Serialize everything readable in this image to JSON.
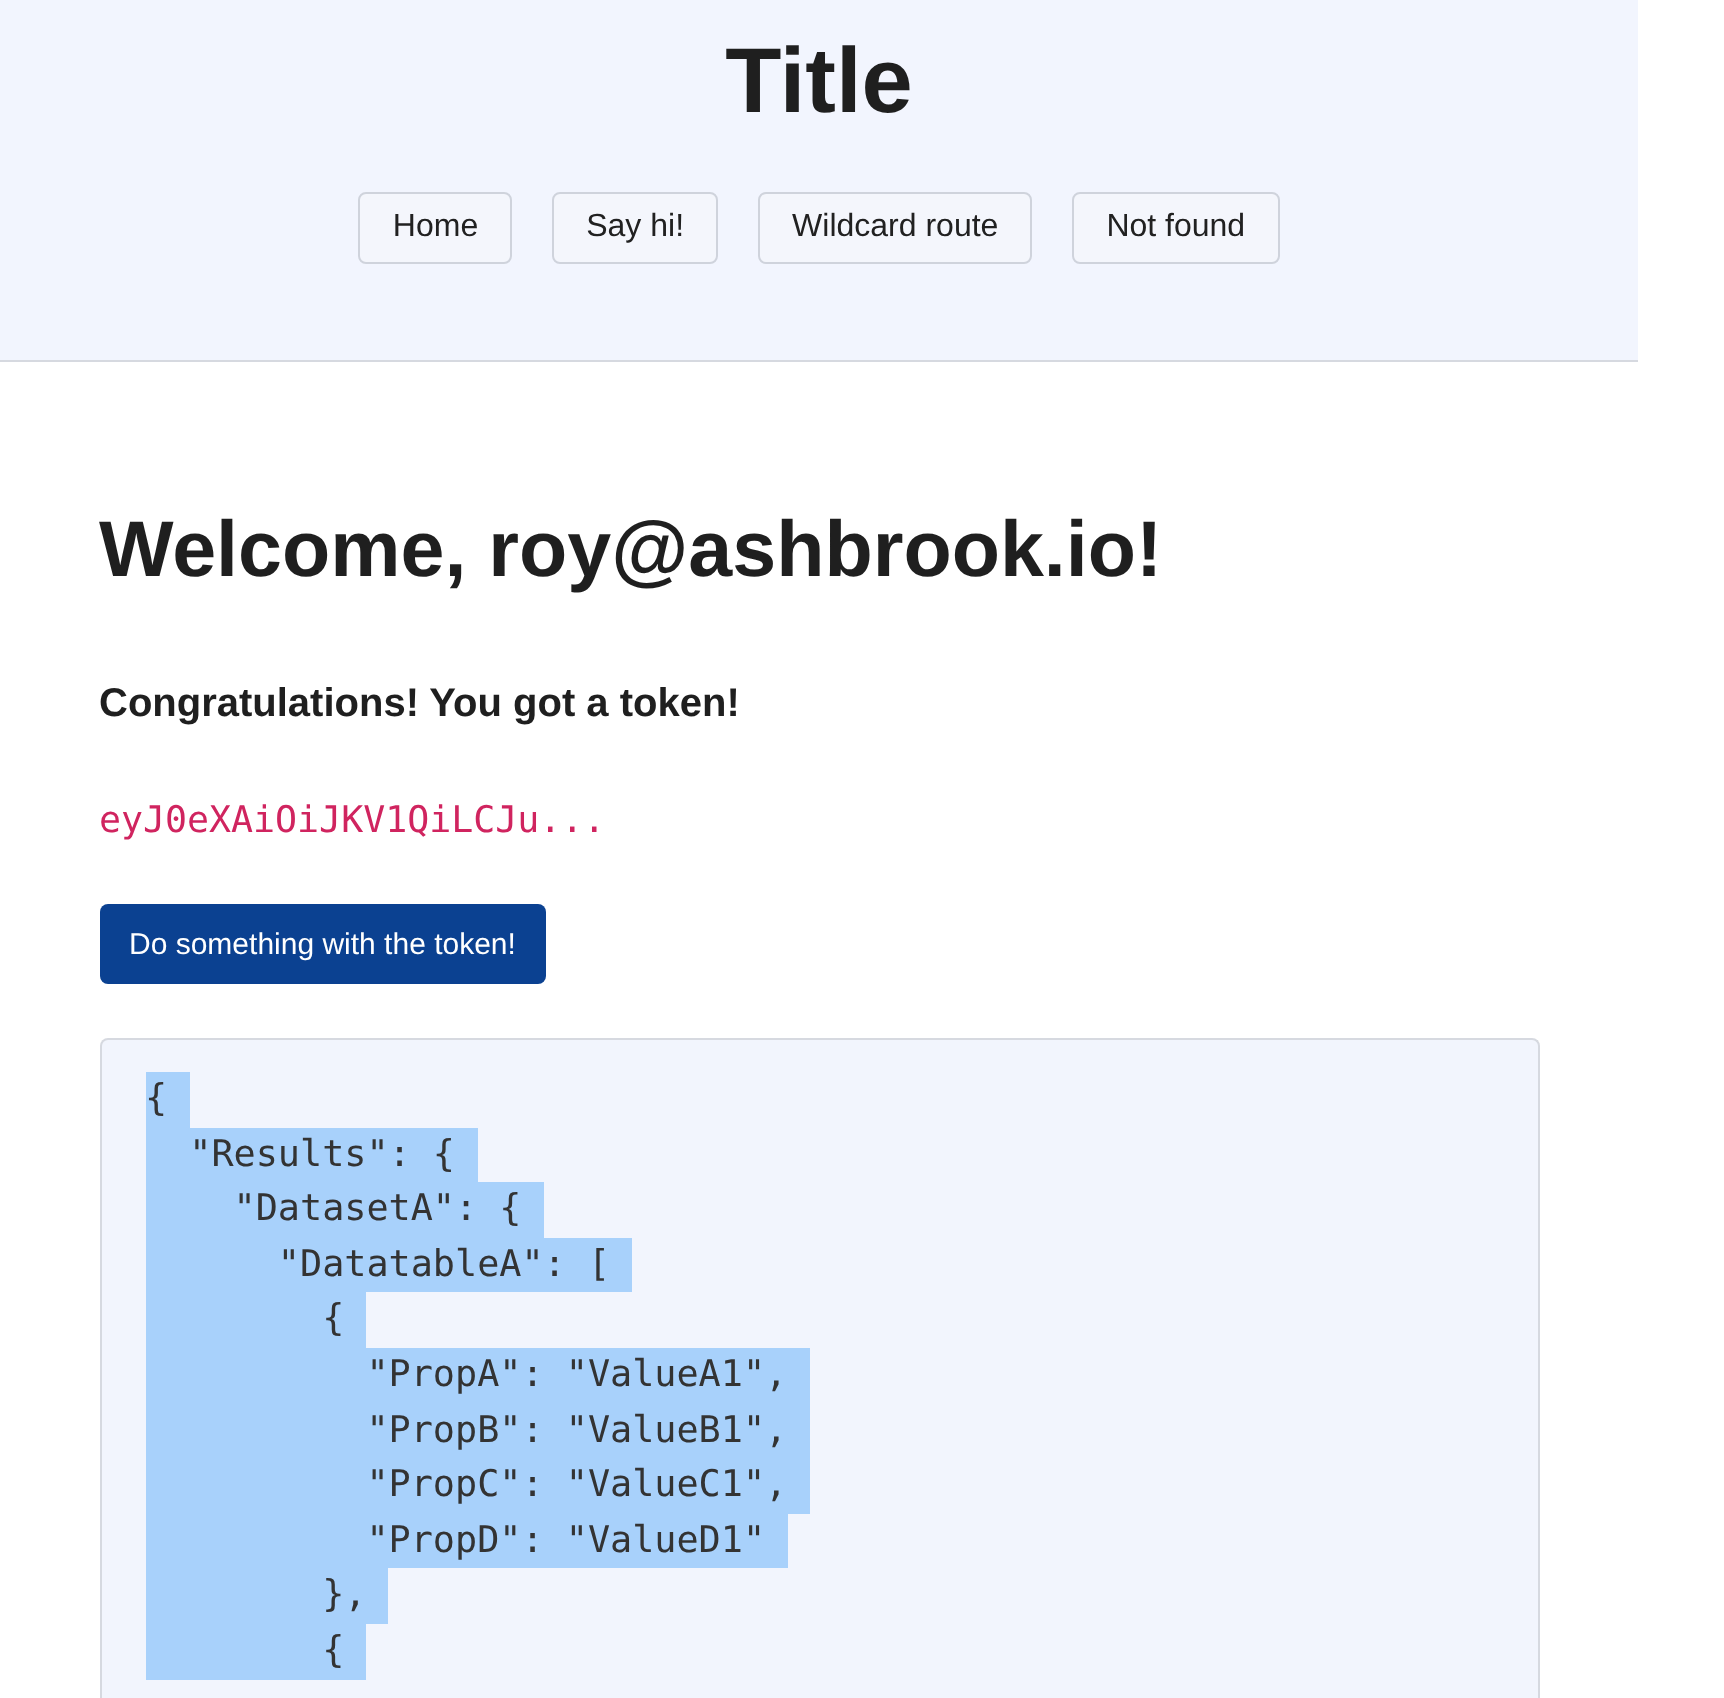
{
  "header": {
    "title": "Title",
    "nav": [
      {
        "label": "Home"
      },
      {
        "label": "Say hi!"
      },
      {
        "label": "Wildcard route"
      },
      {
        "label": "Not found"
      }
    ]
  },
  "main": {
    "heading": "Welcome, roy@ashbrook.io!",
    "subheading": "Congratulations! You got a token!",
    "token": "eyJ0eXAiOiJKV1QiLCJu...",
    "action_button": "Do something with the token!",
    "code_block": {
      "highlighted": true,
      "lines": [
        "{",
        "  \"Results\": {",
        "    \"DatasetA\": {",
        "      \"DatatableA\": [",
        "        {",
        "          \"PropA\": \"ValueA1\",",
        "          \"PropB\": \"ValueB1\",",
        "          \"PropC\": \"ValueC1\",",
        "          \"PropD\": \"ValueD1\"",
        "        },",
        "        {"
      ]
    }
  }
}
